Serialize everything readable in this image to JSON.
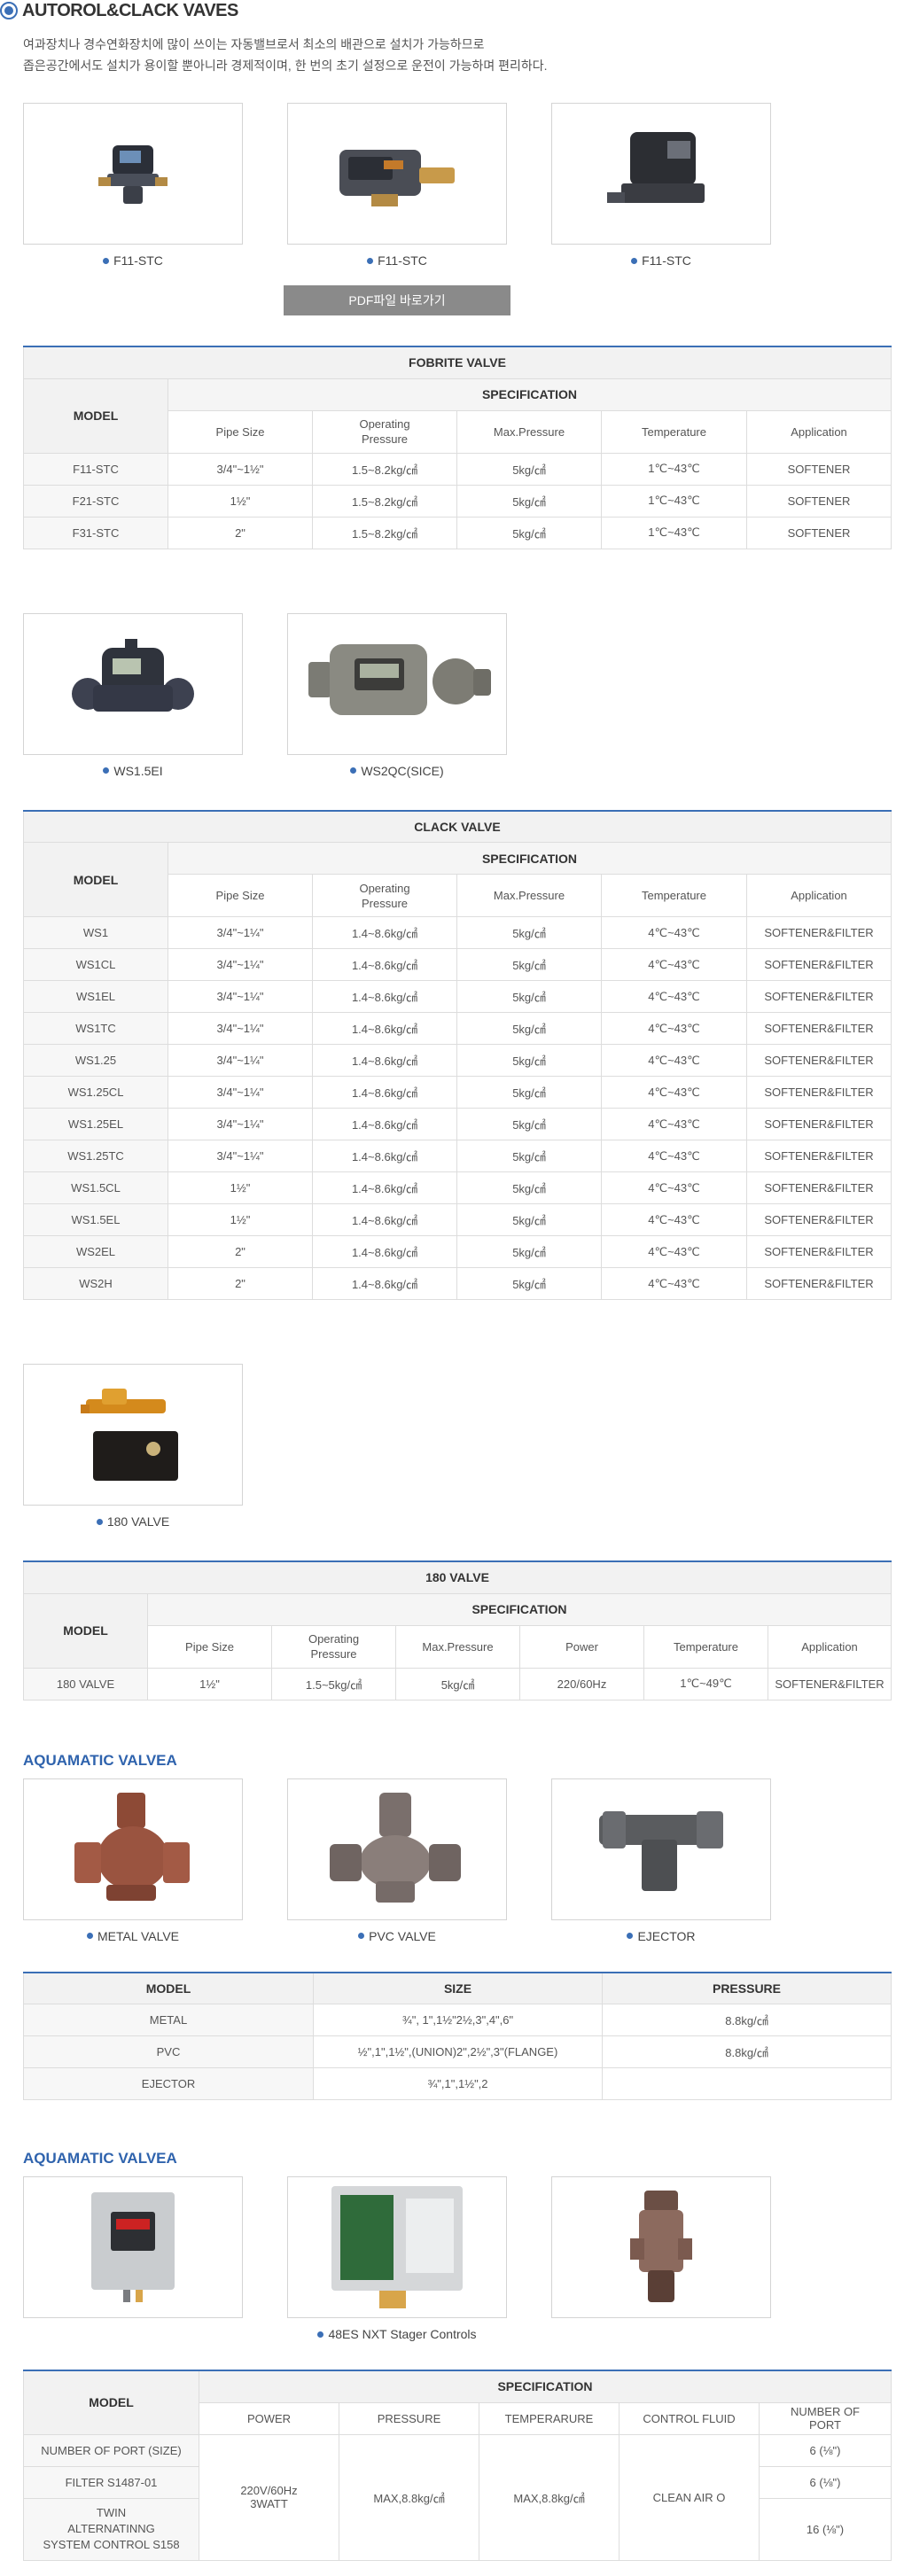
{
  "header": {
    "title": "AUTOROL&CLACK VAVES",
    "intro_line1": "여과장치나 경수연화장치에 많이 쓰이는 자동밸브로서 최소의 배관으로 설치가 가능하므로",
    "intro_line2": "좁은공간에서도 설치가 용이할 뿐아니라 경제적이며, 한 번의 초기 설정으로 운전이 가능하며 편리하다."
  },
  "autorol": {
    "thumbs": [
      {
        "caption": "F11-STC",
        "icon": "control-valve-icon"
      },
      {
        "caption": "F11-STC",
        "icon": "valve-timer-icon"
      },
      {
        "caption": "F11-STC",
        "icon": "valve-box-icon"
      }
    ],
    "pdf_button": "PDF파일 바로가기"
  },
  "fobrite_table": {
    "caption": "FOBRITE VALVE",
    "model_header": "MODEL",
    "spec_header": "SPECIFICATION",
    "columns": [
      "Pipe Size",
      "Operating\nPressure",
      "Max.Pressure",
      "Temperature",
      "Application"
    ],
    "rows": [
      [
        "F11-STC",
        "3/4\"~1½\"",
        "1.5~8.2kg/㎠",
        "5kg/㎠",
        "1℃~43℃",
        "SOFTENER"
      ],
      [
        "F21-STC",
        "1½\"",
        "1.5~8.2kg/㎠",
        "5kg/㎠",
        "1℃~43℃",
        "SOFTENER"
      ],
      [
        "F31-STC",
        "2\"",
        "1.5~8.2kg/㎠",
        "5kg/㎠",
        "1℃~43℃",
        "SOFTENER"
      ]
    ]
  },
  "clack": {
    "thumbs": [
      {
        "caption": "WS1.5EI",
        "icon": "clack-valve-icon"
      },
      {
        "caption": "WS2QC(SICE)",
        "icon": "clack-valve-large-icon"
      }
    ]
  },
  "clack_table": {
    "caption": "CLACK VALVE",
    "model_header": "MODEL",
    "spec_header": "SPECIFICATION",
    "columns": [
      "Pipe Size",
      "Operating\nPressure",
      "Max.Pressure",
      "Temperature",
      "Application"
    ],
    "rows": [
      [
        "WS1",
        "3/4\"~1¼\"",
        "1.4~8.6kg/㎠",
        "5kg/㎠",
        "4℃~43℃",
        "SOFTENER&FILTER"
      ],
      [
        "WS1CL",
        "3/4\"~1¼\"",
        "1.4~8.6kg/㎠",
        "5kg/㎠",
        "4℃~43℃",
        "SOFTENER&FILTER"
      ],
      [
        "WS1EL",
        "3/4\"~1¼\"",
        "1.4~8.6kg/㎠",
        "5kg/㎠",
        "4℃~43℃",
        "SOFTENER&FILTER"
      ],
      [
        "WS1TC",
        "3/4\"~1¼\"",
        "1.4~8.6kg/㎠",
        "5kg/㎠",
        "4℃~43℃",
        "SOFTENER&FILTER"
      ],
      [
        "WS1.25",
        "3/4\"~1¼\"",
        "1.4~8.6kg/㎠",
        "5kg/㎠",
        "4℃~43℃",
        "SOFTENER&FILTER"
      ],
      [
        "WS1.25CL",
        "3/4\"~1¼\"",
        "1.4~8.6kg/㎠",
        "5kg/㎠",
        "4℃~43℃",
        "SOFTENER&FILTER"
      ],
      [
        "WS1.25EL",
        "3/4\"~1¼\"",
        "1.4~8.6kg/㎠",
        "5kg/㎠",
        "4℃~43℃",
        "SOFTENER&FILTER"
      ],
      [
        "WS1.25TC",
        "3/4\"~1¼\"",
        "1.4~8.6kg/㎠",
        "5kg/㎠",
        "4℃~43℃",
        "SOFTENER&FILTER"
      ],
      [
        "WS1.5CL",
        "1½\"",
        "1.4~8.6kg/㎠",
        "5kg/㎠",
        "4℃~43℃",
        "SOFTENER&FILTER"
      ],
      [
        "WS1.5EL",
        "1½\"",
        "1.4~8.6kg/㎠",
        "5kg/㎠",
        "4℃~43℃",
        "SOFTENER&FILTER"
      ],
      [
        "WS2EL",
        "2\"",
        "1.4~8.6kg/㎠",
        "5kg/㎠",
        "4℃~43℃",
        "SOFTENER&FILTER"
      ],
      [
        "WS2H",
        "2\"",
        "1.4~8.6kg/㎠",
        "5kg/㎠",
        "4℃~43℃",
        "SOFTENER&FILTER"
      ]
    ]
  },
  "valve180": {
    "thumbs": [
      {
        "caption": "180 VALVE",
        "icon": "valve-180-icon"
      }
    ]
  },
  "valve180_table": {
    "caption": "180 VALVE",
    "model_header": "MODEL",
    "spec_header": "SPECIFICATION",
    "columns": [
      "Pipe Size",
      "Operating\nPressure",
      "Max.Pressure",
      "Power",
      "Temperature",
      "Application"
    ],
    "rows": [
      [
        "180 VALVE",
        "1½\"",
        "1.5~5kg/㎠",
        "5kg/㎠",
        "220/60Hz",
        "1℃~49℃",
        "SOFTENER&FILTER"
      ]
    ]
  },
  "aquamatic1": {
    "title": "AQUAMATIC VALVEA",
    "thumbs": [
      {
        "caption": "METAL VALVE",
        "icon": "metal-valve-icon"
      },
      {
        "caption": "PVC VALVE",
        "icon": "pvc-valve-icon"
      },
      {
        "caption": "EJECTOR",
        "icon": "ejector-icon"
      }
    ]
  },
  "aquamatic1_table": {
    "columns": [
      "MODEL",
      "SIZE",
      "PRESSURE"
    ],
    "rows": [
      [
        "METAL",
        "¾\", 1\",1½\"2½,3\",4\",6\"",
        "8.8kg/㎠"
      ],
      [
        "PVC",
        "½\",1\",1½\",(UNION)2\",2½\",3\"(FLANGE)",
        "8.8kg/㎠"
      ],
      [
        "EJECTOR",
        "¾\",1\",1½\",2",
        ""
      ]
    ]
  },
  "aquamatic2": {
    "title": "AQUAMATIC VALVEA",
    "thumbs": [
      {
        "caption": "",
        "icon": "controller-box-icon"
      },
      {
        "caption": "48ES NXT Stager Controls",
        "icon": "stager-control-icon"
      },
      {
        "caption": "",
        "icon": "piston-valve-icon"
      }
    ]
  },
  "aquamatic2_table": {
    "model_header": "MODEL",
    "spec_header": "SPECIFICATION",
    "columns": [
      "POWER",
      "PRESSURE",
      "TEMPERARURE",
      "CONTROL  FLUID",
      "NUMBER OF\nPORT"
    ],
    "models": [
      "NUMBER OF PORT (SIZE)",
      "FILTER S1487-01",
      "TWIN\nALTERNATINNG\nSYSTEM CONTROL S158"
    ],
    "power": "220V/60Hz\n3WATT",
    "pressure": "MAX,8.8kg/㎠",
    "temperature": "MAX,8.8kg/㎠",
    "control_fluid": "CLEAN AIR O",
    "ports": [
      "6 (⅛\")",
      "6 (⅛\")",
      "16 (⅛\")"
    ]
  },
  "colors": {
    "accent": "#3b6fb6",
    "section_title": "#2f63ad",
    "button": "#8a8a8a"
  }
}
